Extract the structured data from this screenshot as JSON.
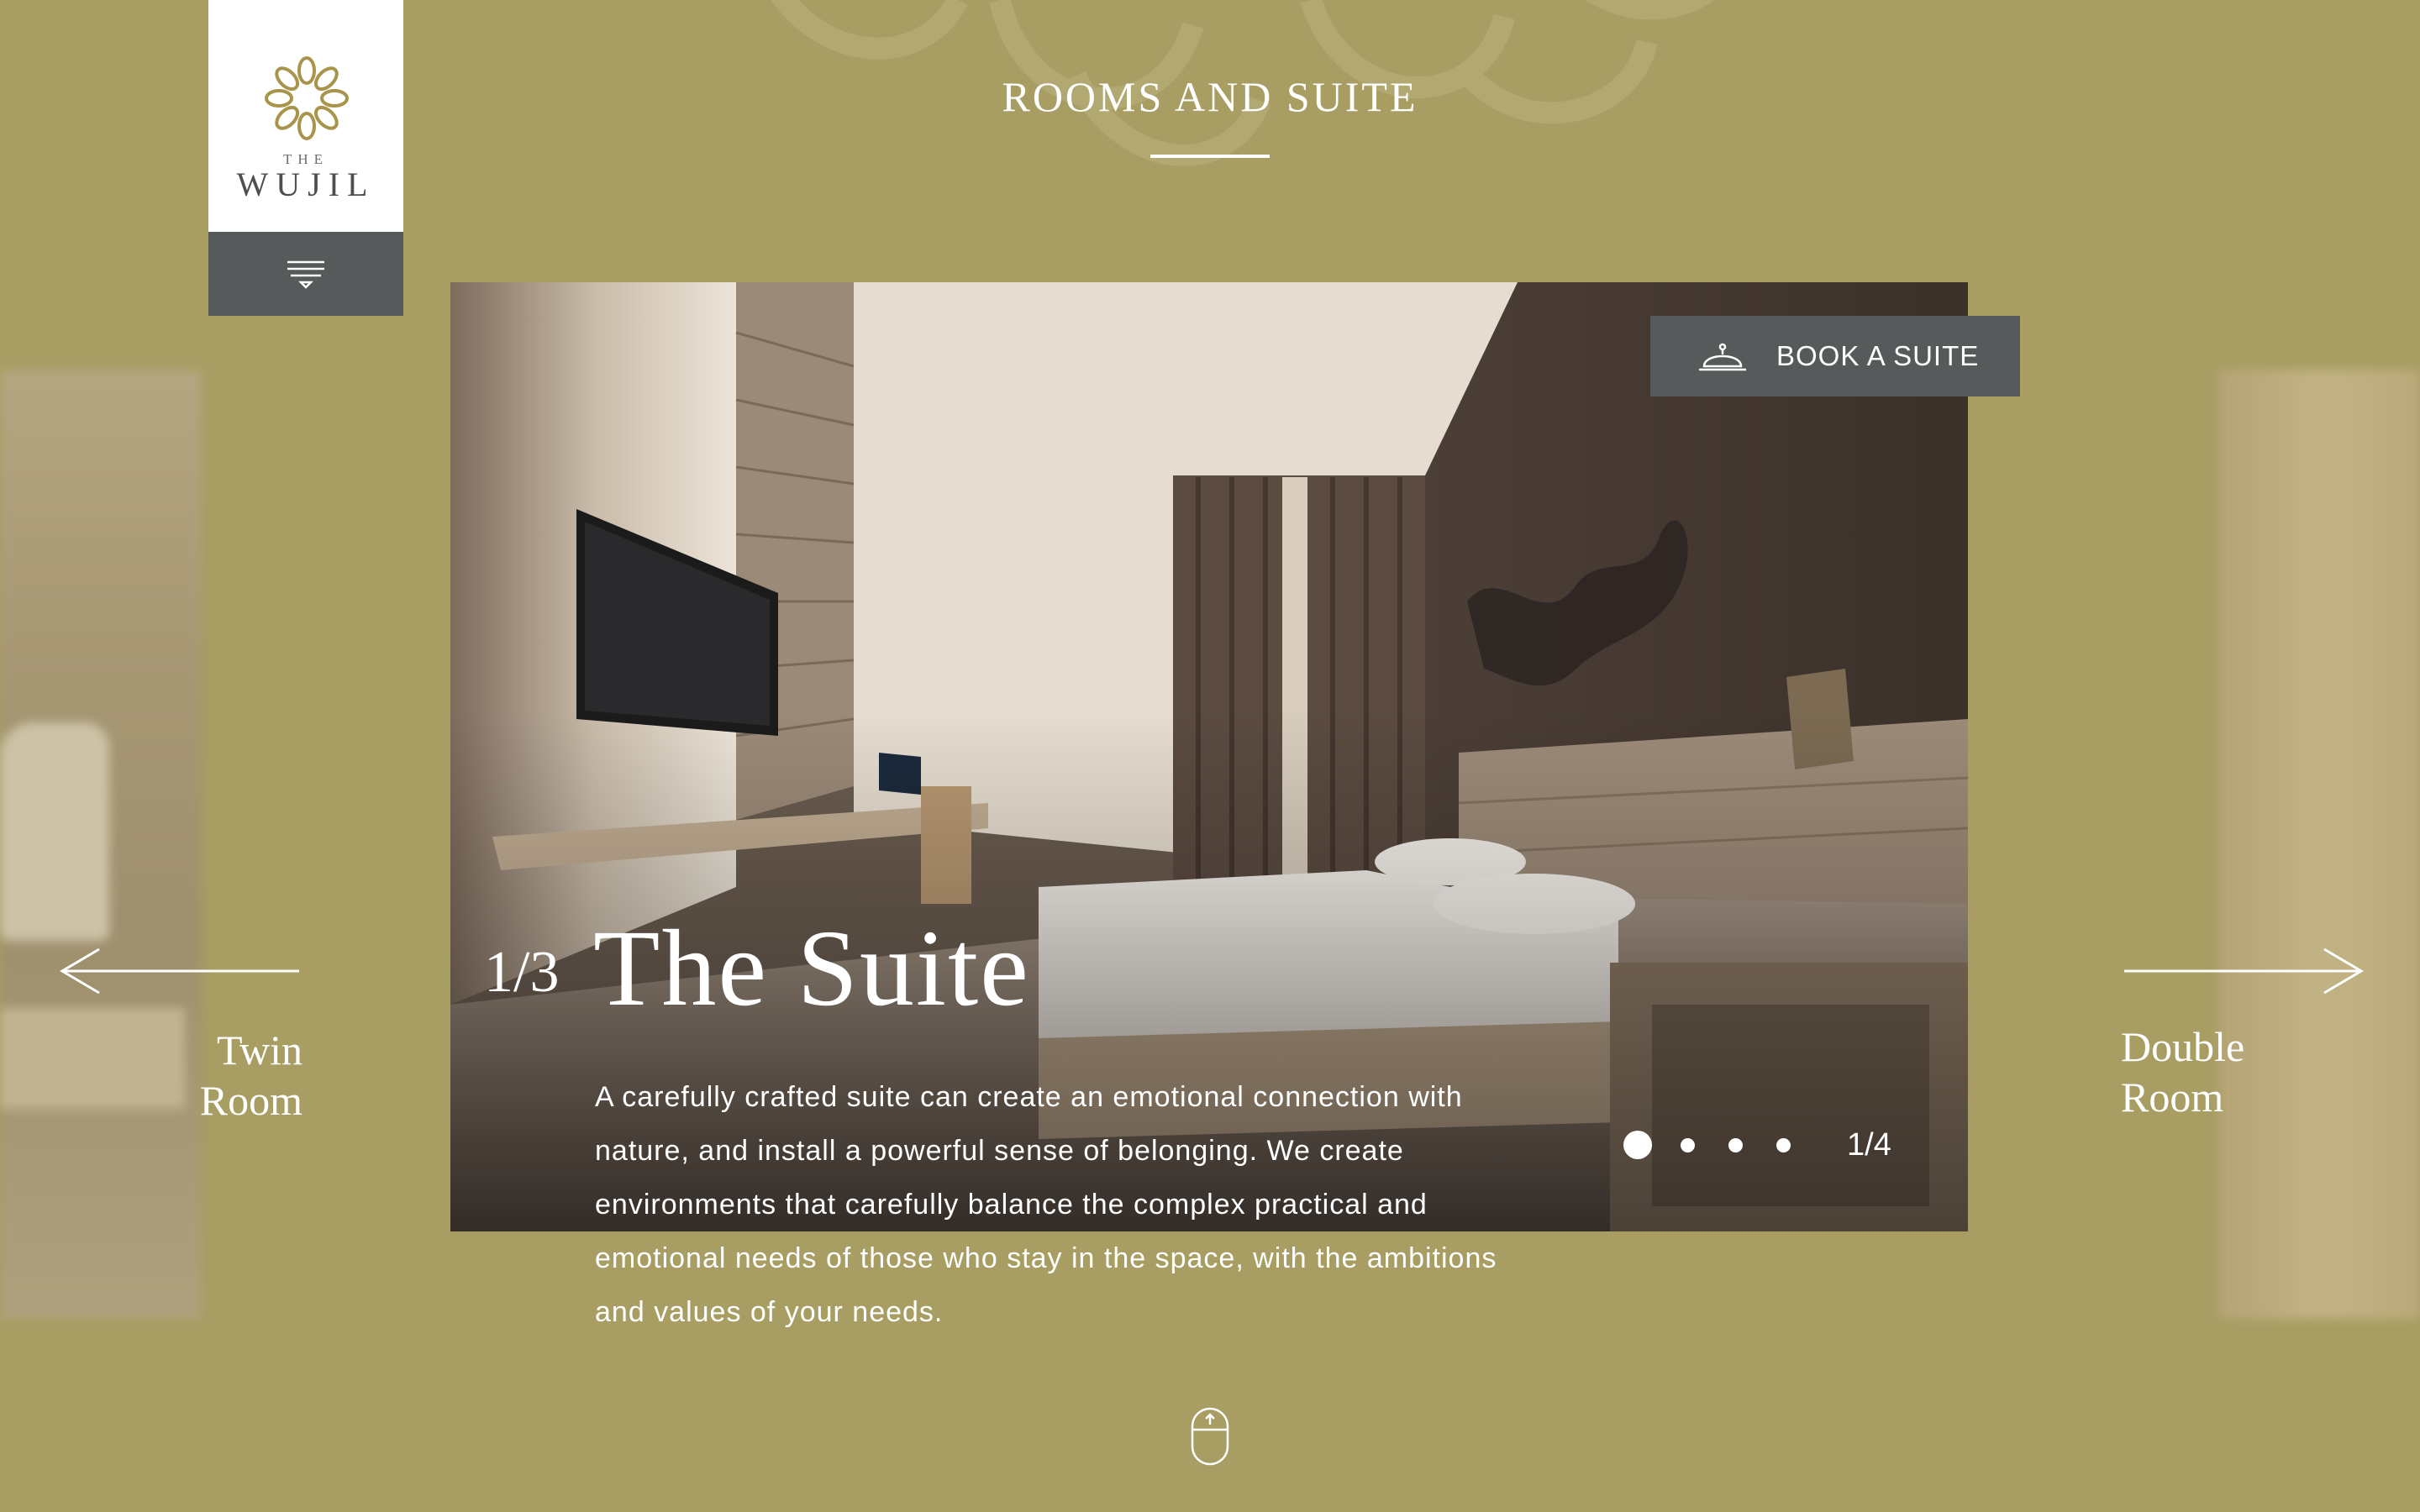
{
  "brand": {
    "the": "THE",
    "name": "WUJIL"
  },
  "header": {
    "section_title": "ROOMS AND SUITE"
  },
  "hero": {
    "book_label": "BOOK A SUITE",
    "room_index": "1/3",
    "room_title": "The Suite",
    "description": "A carefully crafted suite can create an emotional connection with nature, and install a powerful sense of belonging. We create environments that carefully balance the complex practical and emotional needs of those who stay in the space, with the ambitions and values of your needs.",
    "slide_count": "1/4",
    "slides_total": 4,
    "active_slide": 1
  },
  "nav": {
    "prev_line1": "Twin",
    "prev_line2": "Room",
    "next_line1": "Double",
    "next_line2": "Room"
  },
  "colors": {
    "background": "#a89d62",
    "button_bg": "#565a5b",
    "logo_gold": "#a8944a",
    "text": "#ffffff"
  },
  "icons": {
    "logo": "flower-logo-icon",
    "menu": "menu-icon",
    "book": "service-bell-icon",
    "prev": "arrow-left-icon",
    "next": "arrow-right-icon",
    "scroll": "mouse-scroll-icon"
  }
}
